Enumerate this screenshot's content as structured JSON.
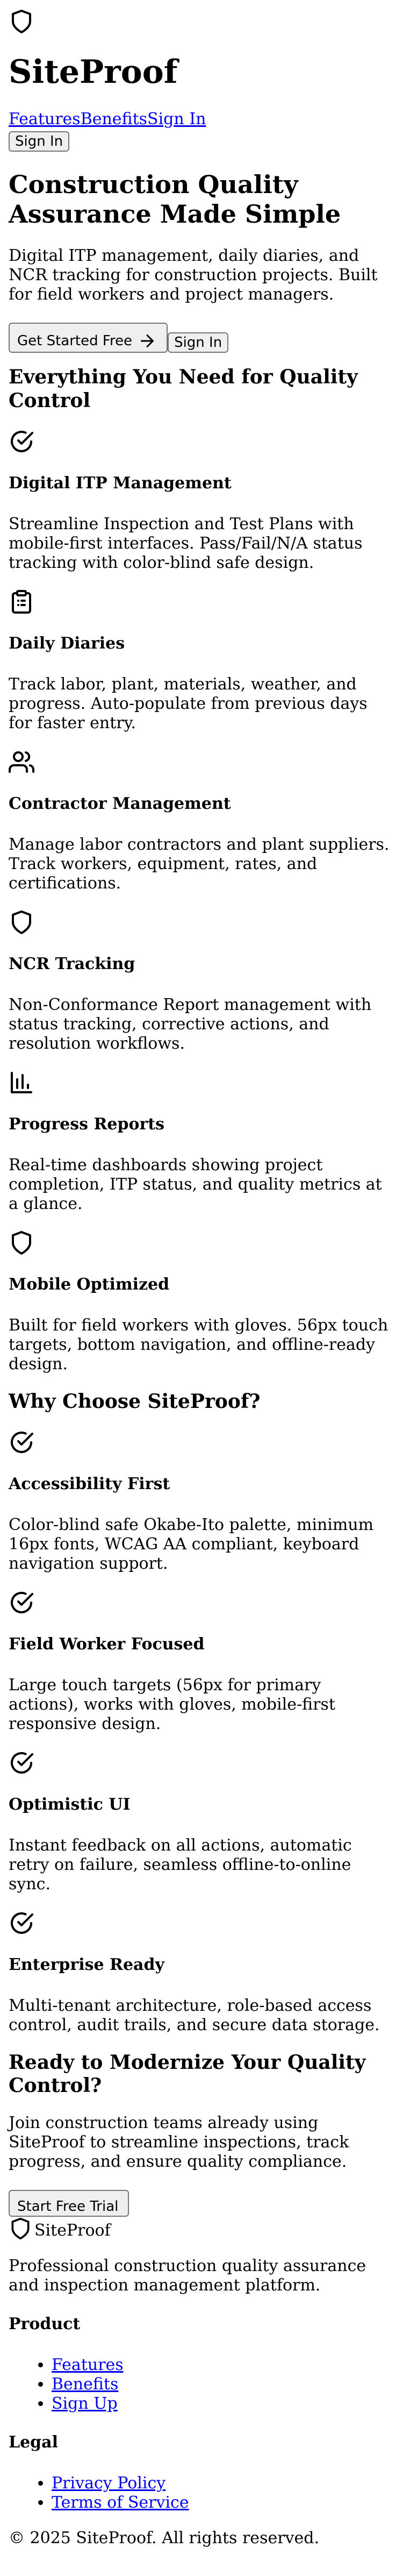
{
  "header": {
    "brand": "SiteProof",
    "nav": [
      "Features",
      "Benefits",
      "Sign In"
    ],
    "sign_in_button": "Sign In"
  },
  "hero": {
    "title": "Construction Quality Assurance Made Simple",
    "subtitle": "Digital ITP management, daily diaries, and NCR tracking for construction projects. Built for field workers and project managers.",
    "cta_primary": "Get Started Free",
    "cta_secondary": "Sign In"
  },
  "features": {
    "heading": "Everything You Need for Quality Control",
    "items": [
      {
        "icon": "check-circle-icon",
        "title": "Digital ITP Management",
        "desc": "Streamline Inspection and Test Plans with mobile-first interfaces. Pass/Fail/N/A status tracking with color-blind safe design."
      },
      {
        "icon": "clipboard-icon",
        "title": "Daily Diaries",
        "desc": "Track labor, plant, materials, weather, and progress. Auto-populate from previous days for faster entry."
      },
      {
        "icon": "users-icon",
        "title": "Contractor Management",
        "desc": "Manage labor contractors and plant suppliers. Track workers, equipment, rates, and certifications."
      },
      {
        "icon": "shield-icon",
        "title": "NCR Tracking",
        "desc": "Non-Conformance Report management with status tracking, corrective actions, and resolution workflows."
      },
      {
        "icon": "bar-chart-icon",
        "title": "Progress Reports",
        "desc": "Real-time dashboards showing project completion, ITP status, and quality metrics at a glance."
      },
      {
        "icon": "shield-icon",
        "title": "Mobile Optimized",
        "desc": "Built for field workers with gloves. 56px touch targets, bottom navigation, and offline-ready design."
      }
    ]
  },
  "benefits": {
    "heading": "Why Choose SiteProof?",
    "items": [
      {
        "icon": "check-circle-icon",
        "title": "Accessibility First",
        "desc": "Color-blind safe Okabe-Ito palette, minimum 16px fonts, WCAG AA compliant, keyboard navigation support."
      },
      {
        "icon": "check-circle-icon",
        "title": "Field Worker Focused",
        "desc": "Large touch targets (56px for primary actions), works with gloves, mobile-first responsive design."
      },
      {
        "icon": "check-circle-icon",
        "title": "Optimistic UI",
        "desc": "Instant feedback on all actions, automatic retry on failure, seamless offline-to-online sync."
      },
      {
        "icon": "check-circle-icon",
        "title": "Enterprise Ready",
        "desc": "Multi-tenant architecture, role-based access control, audit trails, and secure data storage."
      }
    ]
  },
  "cta": {
    "heading": "Ready to Modernize Your Quality Control?",
    "text": "Join construction teams already using SiteProof to streamline inspections, track progress, and ensure quality compliance.",
    "button": "Start Free Trial"
  },
  "footer": {
    "brand": "SiteProof",
    "tagline": "Professional construction quality assurance and inspection management platform.",
    "product_heading": "Product",
    "product_links": [
      "Features",
      "Benefits",
      "Sign Up"
    ],
    "legal_heading": "Legal",
    "legal_links": [
      "Privacy Policy",
      "Terms of Service"
    ],
    "copyright": "© 2025 SiteProof. All rights reserved."
  }
}
